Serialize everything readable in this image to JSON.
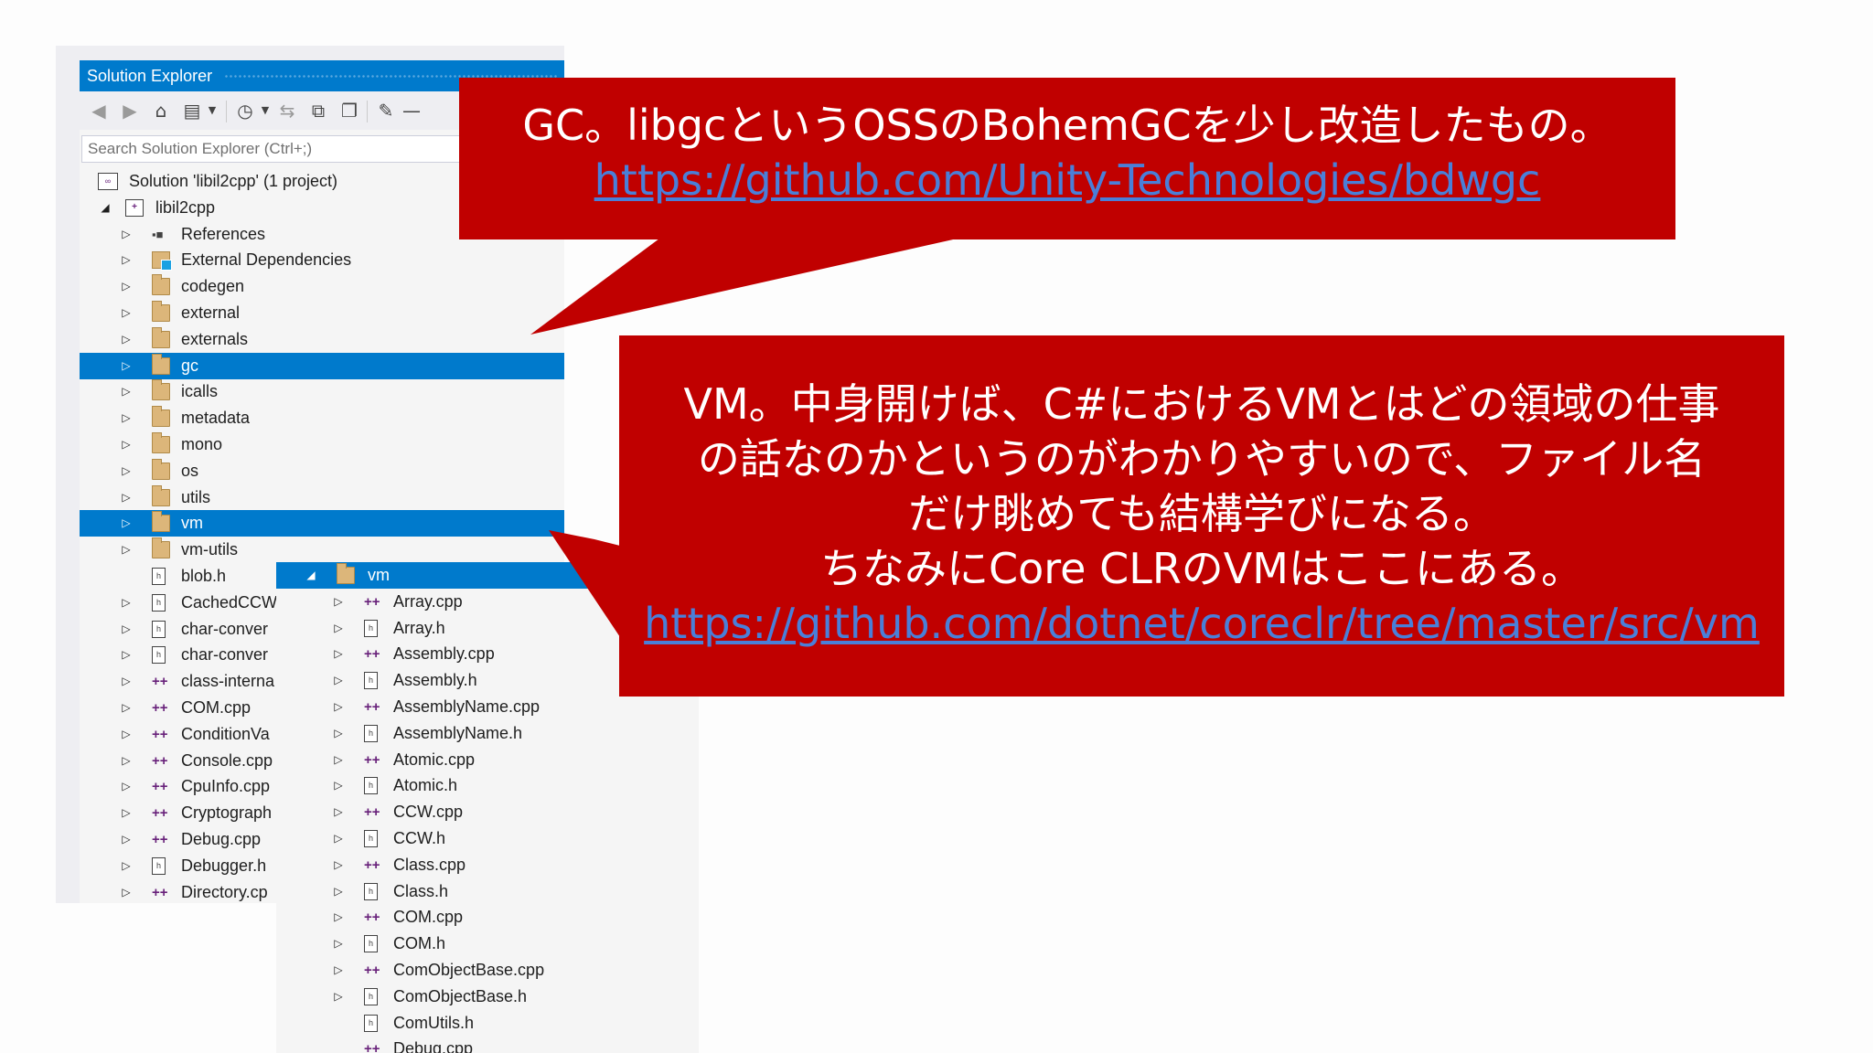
{
  "solution_explorer": {
    "title": "Solution Explorer",
    "search_placeholder": "Search Solution Explorer (Ctrl+;)",
    "toolbar_icons": [
      "back-icon",
      "forward-icon",
      "home-icon",
      "switch-views-icon",
      "history-icon",
      "sync-icon",
      "collapse-all-icon",
      "show-all-files-icon",
      "properties-icon",
      "pin-icon"
    ],
    "tree": [
      {
        "label": "Solution 'libil2cpp' (1 project)",
        "icon": "solution-icon",
        "expander": "",
        "indent": 0
      },
      {
        "label": "libil2cpp",
        "icon": "project-icon",
        "expander": "◢",
        "indent": 1
      },
      {
        "label": "References",
        "icon": "references-icon",
        "expander": "▷",
        "indent": 2
      },
      {
        "label": "External Dependencies",
        "icon": "external-dependencies-icon",
        "expander": "▷",
        "indent": 2
      },
      {
        "label": "codegen",
        "icon": "folder-icon",
        "expander": "▷",
        "indent": 2
      },
      {
        "label": "external",
        "icon": "folder-icon",
        "expander": "▷",
        "indent": 2
      },
      {
        "label": "externals",
        "icon": "folder-icon",
        "expander": "▷",
        "indent": 2
      },
      {
        "label": "gc",
        "icon": "folder-icon",
        "expander": "▷",
        "indent": 2,
        "selected": true
      },
      {
        "label": "icalls",
        "icon": "folder-icon",
        "expander": "▷",
        "indent": 2
      },
      {
        "label": "metadata",
        "icon": "folder-icon",
        "expander": "▷",
        "indent": 2
      },
      {
        "label": "mono",
        "icon": "folder-icon",
        "expander": "▷",
        "indent": 2
      },
      {
        "label": "os",
        "icon": "folder-icon",
        "expander": "▷",
        "indent": 2
      },
      {
        "label": "utils",
        "icon": "folder-icon",
        "expander": "▷",
        "indent": 2
      },
      {
        "label": "vm",
        "icon": "folder-icon",
        "expander": "▷",
        "indent": 2,
        "selected": true
      },
      {
        "label": "vm-utils",
        "icon": "folder-icon",
        "expander": "▷",
        "indent": 2
      },
      {
        "label": "blob.h",
        "icon": "header-file-icon",
        "expander": "",
        "indent": 2
      },
      {
        "label": "CachedCCW",
        "icon": "header-file-icon",
        "expander": "▷",
        "indent": 2
      },
      {
        "label": "char-conver",
        "icon": "header-file-icon",
        "expander": "▷",
        "indent": 2
      },
      {
        "label": "char-conver",
        "icon": "header-file-icon",
        "expander": "▷",
        "indent": 2
      },
      {
        "label": "class-interna",
        "icon": "cpp-file-icon",
        "expander": "▷",
        "indent": 2
      },
      {
        "label": "COM.cpp",
        "icon": "cpp-file-icon",
        "expander": "▷",
        "indent": 2
      },
      {
        "label": "ConditionVa",
        "icon": "cpp-file-icon",
        "expander": "▷",
        "indent": 2
      },
      {
        "label": "Console.cpp",
        "icon": "cpp-file-icon",
        "expander": "▷",
        "indent": 2
      },
      {
        "label": "CpuInfo.cpp",
        "icon": "cpp-file-icon",
        "expander": "▷",
        "indent": 2
      },
      {
        "label": "Cryptograph",
        "icon": "cpp-file-icon",
        "expander": "▷",
        "indent": 2
      },
      {
        "label": "Debug.cpp",
        "icon": "cpp-file-icon",
        "expander": "▷",
        "indent": 2
      },
      {
        "label": "Debugger.h",
        "icon": "header-file-icon",
        "expander": "▷",
        "indent": 2
      },
      {
        "label": "Directory.cp",
        "icon": "cpp-file-icon",
        "expander": "▷",
        "indent": 2
      }
    ]
  },
  "vm_folder": {
    "header": {
      "label": "vm",
      "expander": "◢",
      "icon": "folder-icon"
    },
    "files": [
      {
        "label": "Array.cpp",
        "icon": "cpp-file-icon",
        "expander": "▷"
      },
      {
        "label": "Array.h",
        "icon": "header-file-icon",
        "expander": "▷"
      },
      {
        "label": "Assembly.cpp",
        "icon": "cpp-file-icon",
        "expander": "▷"
      },
      {
        "label": "Assembly.h",
        "icon": "header-file-icon",
        "expander": "▷"
      },
      {
        "label": "AssemblyName.cpp",
        "icon": "cpp-file-icon",
        "expander": "▷"
      },
      {
        "label": "AssemblyName.h",
        "icon": "header-file-icon",
        "expander": "▷"
      },
      {
        "label": "Atomic.cpp",
        "icon": "cpp-file-icon",
        "expander": "▷"
      },
      {
        "label": "Atomic.h",
        "icon": "header-file-icon",
        "expander": "▷"
      },
      {
        "label": "CCW.cpp",
        "icon": "cpp-file-icon",
        "expander": "▷"
      },
      {
        "label": "CCW.h",
        "icon": "header-file-icon",
        "expander": "▷"
      },
      {
        "label": "Class.cpp",
        "icon": "cpp-file-icon",
        "expander": "▷"
      },
      {
        "label": "Class.h",
        "icon": "header-file-icon",
        "expander": "▷"
      },
      {
        "label": "COM.cpp",
        "icon": "cpp-file-icon",
        "expander": "▷"
      },
      {
        "label": "COM.h",
        "icon": "header-file-icon",
        "expander": "▷"
      },
      {
        "label": "ComObjectBase.cpp",
        "icon": "cpp-file-icon",
        "expander": "▷"
      },
      {
        "label": "ComObjectBase.h",
        "icon": "header-file-icon",
        "expander": "▷"
      },
      {
        "label": "ComUtils.h",
        "icon": "header-file-icon",
        "expander": ""
      },
      {
        "label": "Debug.cpp",
        "icon": "cpp-file-icon",
        "expander": ""
      }
    ]
  },
  "callouts": [
    {
      "lines": [
        "GC。libgcというOSSのBohemGCを少し改造したもの。"
      ],
      "link": "https://github.com/Unity-Technologies/bdwgc"
    },
    {
      "lines": [
        "VM。中身開けば、C#におけるVMとはどの領域の仕事",
        "の話なのかというのがわかりやすいので、ファイル名",
        "だけ眺めても結構学びになる。",
        "ちなみにCore CLRのVMはここにある。"
      ],
      "link": "https://github.com/dotnet/coreclr/tree/master/src/vm"
    }
  ],
  "colors": {
    "callout_red": "#c00000",
    "selection_blue": "#007acc",
    "link_blue": "#4a7fd8"
  }
}
